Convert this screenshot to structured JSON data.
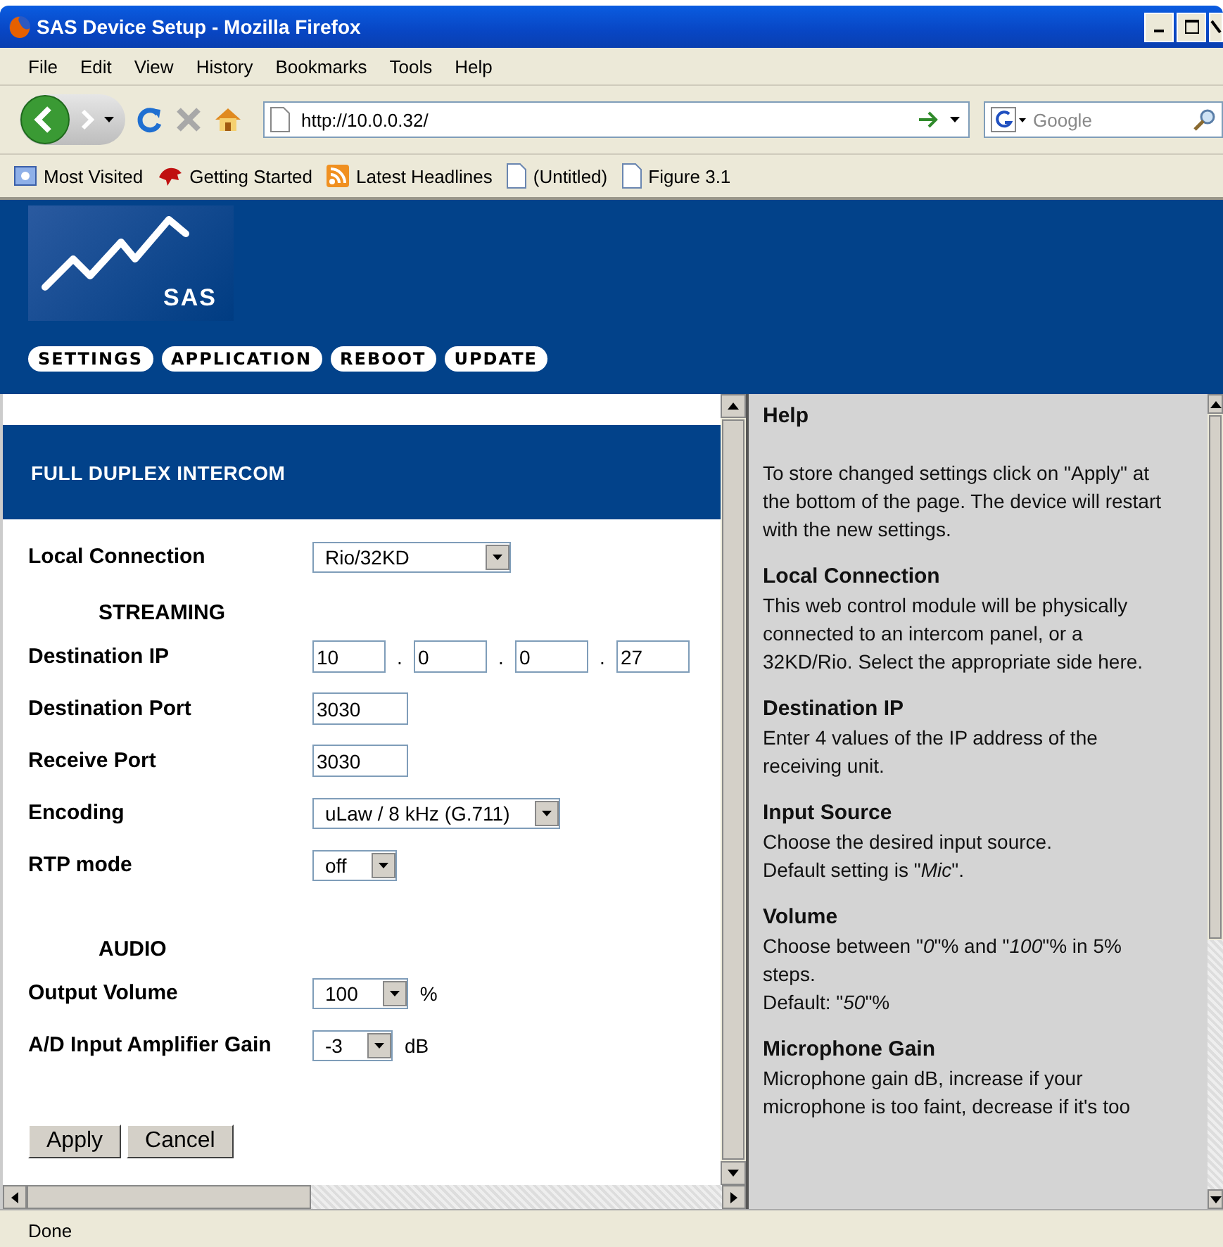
{
  "window": {
    "title": "SAS Device Setup - Mozilla Firefox"
  },
  "menu": [
    "File",
    "Edit",
    "View",
    "History",
    "Bookmarks",
    "Tools",
    "Help"
  ],
  "address_bar": {
    "value": "http://10.0.0.32/"
  },
  "search": {
    "placeholder": "Google"
  },
  "bookmarks": [
    {
      "label": "Most Visited",
      "kind": "folder"
    },
    {
      "label": "Getting Started",
      "kind": "bird"
    },
    {
      "label": "Latest Headlines",
      "kind": "feed"
    },
    {
      "label": "(Untitled)",
      "kind": "page"
    },
    {
      "label": "Figure 3.1",
      "kind": "page"
    }
  ],
  "logo": {
    "text": "SAS"
  },
  "nav": [
    "SETTINGS",
    "APPLICATION",
    "REBOOT",
    "UPDATE"
  ],
  "form": {
    "title": "FULL DUPLEX INTERCOM",
    "rows": [
      {
        "kind": "select",
        "label": "Local Connection",
        "value": "Rio/32KD"
      },
      {
        "kind": "heading",
        "label": "STREAMING"
      },
      {
        "kind": "ip",
        "label": "Destination IP",
        "values": [
          "10",
          "0",
          "0",
          "27"
        ],
        "separator": "."
      },
      {
        "kind": "text",
        "label": "Destination Port",
        "value": "3030"
      },
      {
        "kind": "text",
        "label": "Receive Port",
        "value": "3030"
      },
      {
        "kind": "select",
        "label": "Encoding",
        "value": "uLaw / 8 kHz (G.711)"
      },
      {
        "kind": "select",
        "label": "RTP mode",
        "value": "off"
      },
      {
        "kind": "heading",
        "label": "AUDIO"
      },
      {
        "kind": "select",
        "label": "Output Volume",
        "value": "100",
        "unit": "%"
      },
      {
        "kind": "select",
        "label": "A/D Input Amplifier Gain",
        "value": "-3",
        "unit": "dB"
      }
    ],
    "buttons": [
      "Apply",
      "Cancel"
    ]
  },
  "help": {
    "title": "Help",
    "sections": [
      {
        "body": [
          "To store changed settings click on \"Apply\" at the bottom of the page. The device will restart with the new settings."
        ]
      },
      {
        "heading": "Local Connection",
        "body": [
          "This web control module will be physically connected to an intercom panel, or a 32KD/Rio. Select the appropriate side here."
        ]
      },
      {
        "heading": "Destination IP",
        "body": [
          "Enter 4 values of the IP address of the receiving unit."
        ]
      },
      {
        "heading": "Input Source",
        "body": [
          "Choose the desired input source.",
          "Default setting is \"*Mic*\"."
        ]
      },
      {
        "heading": "Volume",
        "body": [
          "Choose between \"*0*\"% and \"*100*\"% in 5% steps.",
          "Default: \"*50*\"%"
        ]
      },
      {
        "heading": "Microphone Gain",
        "body": [
          "Microphone gain dB, increase if your microphone is too faint, decrease if it's too"
        ]
      }
    ]
  },
  "status_bar": "Done"
}
